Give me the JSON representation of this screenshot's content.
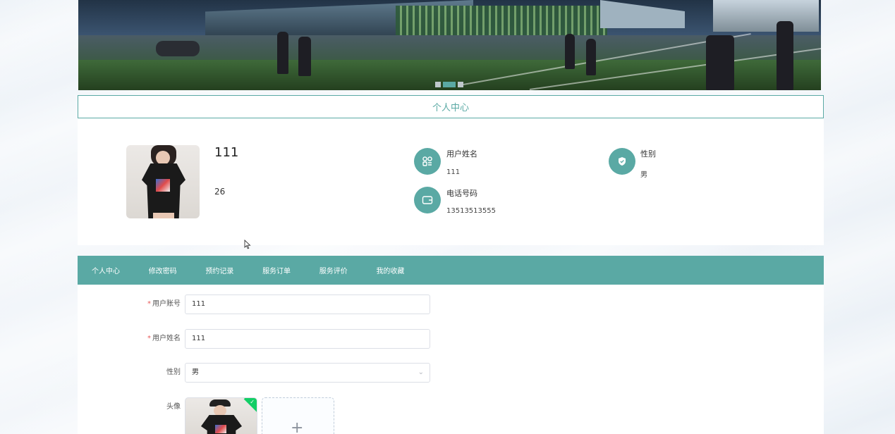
{
  "banner": {
    "active_slide": 2,
    "slide_count": 3
  },
  "section_title": "个人中心",
  "profile": {
    "display_name": "111",
    "age": "26",
    "fields": {
      "username_label": "用户姓名",
      "username_value": "111",
      "gender_label": "性别",
      "gender_value": "男",
      "phone_label": "电话号码",
      "phone_value": "13513513555"
    }
  },
  "nav": {
    "items": [
      "个人中心",
      "修改密码",
      "预约记录",
      "服务订单",
      "服务评价",
      "我的收藏"
    ],
    "active_index": 0
  },
  "form": {
    "account": {
      "label": "用户账号",
      "value": "111",
      "required": "*"
    },
    "name": {
      "label": "用户姓名",
      "value": "111",
      "required": "*"
    },
    "gender": {
      "label": "性别",
      "value": "男"
    },
    "avatar": {
      "label": "头像"
    }
  },
  "colors": {
    "accent": "#5aa9a4",
    "success": "#13ce66",
    "required": "#e85a5a"
  },
  "icons": {
    "username": "apps-icon",
    "gender": "shield-check-icon",
    "phone": "wallet-icon",
    "select": "chevron-down-icon",
    "upload": "plus-icon",
    "uploaded": "check-icon"
  }
}
